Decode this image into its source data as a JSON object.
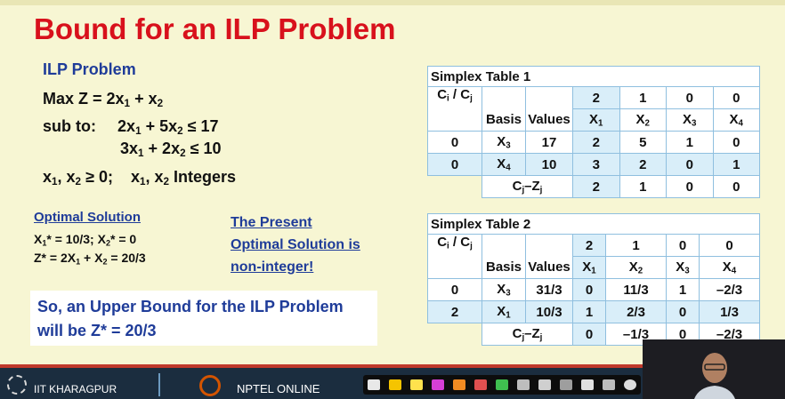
{
  "slide": {
    "title": "Bound for an ILP Problem",
    "problem": {
      "heading": "ILP Problem",
      "objective": {
        "prefix": "Max Z = 2x",
        "mid": " + x"
      },
      "constraint1": {
        "label": "sub to:",
        "a": "2x",
        "b": " + 5x",
        "c": " ≤ 17"
      },
      "constraint2": {
        "a": "3x",
        "b": " + 2x",
        "c": " ≤ 10"
      },
      "nonneg": {
        "a": "x",
        "b": ", x",
        "c": " ≥ 0;",
        "d": "x",
        "e": ", x",
        "f": " Integers"
      }
    },
    "optimal": {
      "heading": "Optimal Solution",
      "line1": {
        "a": "X",
        "b": "* = 10/3; X",
        "c": "* = 0"
      },
      "line2": {
        "a": "Z*",
        "b": " = 2X",
        "c": " + X",
        "d": " = 20/3"
      }
    },
    "present": {
      "line1": "The Present",
      "line2": "Optimal Solution is",
      "line3": "non-integer!"
    },
    "bound": {
      "line1": "So, an Upper Bound for the ILP Problem",
      "line2": "will be Z* = 20/3"
    },
    "table1": {
      "caption": "Simplex Table 1",
      "cj_label": "C",
      "cj_sub_i": "i",
      "cj_sep": " / C",
      "cj_sub_j": "j",
      "basis_header": "Basis",
      "values_header": "Values",
      "costs": [
        "2",
        "1",
        "0",
        "0"
      ],
      "var_letter": "X",
      "var_subs": [
        "1",
        "2",
        "3",
        "4"
      ],
      "rows": [
        {
          "cb": "0",
          "basis_sub": "3",
          "value": "17",
          "coeffs": [
            "2",
            "5",
            "1",
            "0"
          ]
        },
        {
          "cb": "0",
          "basis_sub": "4",
          "value": "10",
          "coeffs": [
            "3",
            "2",
            "0",
            "1"
          ]
        }
      ],
      "czj_label": "C",
      "czj_sep": "–Z",
      "czj": [
        "2",
        "1",
        "0",
        "0"
      ]
    },
    "table2": {
      "caption": "Simplex Table 2",
      "costs": [
        "2",
        "1",
        "0",
        "0"
      ],
      "rows": [
        {
          "cb": "0",
          "basis_sub": "3",
          "value": "31/3",
          "coeffs": [
            "0",
            "11/3",
            "1",
            "–2/3"
          ]
        },
        {
          "cb": "2",
          "basis_sub": "1",
          "value": "10/3",
          "coeffs": [
            "1",
            "2/3",
            "0",
            "1/3"
          ]
        }
      ],
      "czj": [
        "0",
        "–1/3",
        "0",
        "–2/3"
      ]
    }
  },
  "footer": {
    "iit_text": "IIT KHARAGPUR",
    "nptel_text": "NPTEL ONLINE"
  },
  "colors": {
    "title": "#d8111c",
    "heading": "#1f3c99",
    "table_cell": "#d9eef9",
    "footer": "#1b2d3f"
  },
  "toolbar_icons": [
    "pointer-icon",
    "pen-icon",
    "highlighter-icon",
    "marker-icon",
    "pencil-icon",
    "eraser-icon",
    "color-icon",
    "shape-icon",
    "undo-icon",
    "clear-icon",
    "hand-icon",
    "zoom-icon",
    "close-icon"
  ]
}
